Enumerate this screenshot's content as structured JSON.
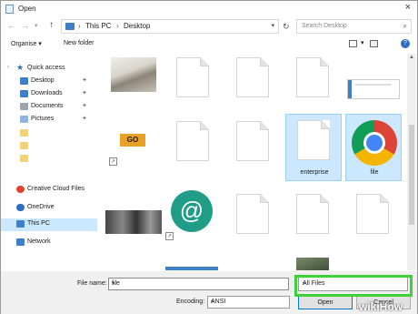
{
  "window": {
    "title": "Open",
    "close_icon": "×"
  },
  "address": {
    "back_icon": "←",
    "forward_icon": "→",
    "dropdown_icon": "▾",
    "up_icon": "↑",
    "crumbs": [
      "This PC",
      "Desktop"
    ],
    "refresh_icon": "↻",
    "search_placeholder": "Search Desktop",
    "search_icon": "⌕"
  },
  "toolbar": {
    "organise": "Organise ▾",
    "new_folder": "New folder",
    "help": "?"
  },
  "nav": {
    "items": [
      {
        "label": "Quick access",
        "icon": "star-icon",
        "color": "#2f6dc2"
      },
      {
        "label": "Desktop",
        "icon": "desktop-icon",
        "color": "#3f7ec8",
        "pin": "📌"
      },
      {
        "label": "Downloads",
        "icon": "download-icon",
        "color": "#3f7ec8",
        "pin": "📌"
      },
      {
        "label": "Documents",
        "icon": "documents-icon",
        "color": "#9aa4b0",
        "pin": "📌"
      },
      {
        "label": "Pictures",
        "icon": "pictures-icon",
        "color": "#8fb5de",
        "pin": "📌"
      },
      {
        "label": "",
        "icon": "folder-icon",
        "color": "#f4d27a"
      },
      {
        "label": "",
        "icon": "folder-icon",
        "color": "#f4d27a"
      },
      {
        "label": "",
        "icon": "folder-icon",
        "color": "#f4d27a"
      },
      {
        "label": "Creative Cloud Files",
        "icon": "creative-cloud-icon",
        "color": "#e0452b"
      },
      {
        "label": "OneDrive",
        "icon": "onedrive-icon",
        "color": "#2f6dc2"
      },
      {
        "label": "This PC",
        "icon": "pc-icon",
        "color": "#3f7ec8"
      },
      {
        "label": "Network",
        "icon": "network-icon",
        "color": "#3f7ec8"
      }
    ]
  },
  "content": {
    "enterprise_label": "enterprise",
    "file_label": "file",
    "shortcut_glyph": "↗",
    "go_label": "GO"
  },
  "bottom": {
    "file_name_label": "File name:",
    "file_name_value": "file",
    "file_type_value": "All Files",
    "encoding_label": "Encoding:",
    "encoding_value": "ANSI",
    "open_button": "Open",
    "cancel_button": "Cancel",
    "dropdown_icon": "▾"
  },
  "watermark": {
    "text": "wikiHow"
  },
  "colors": {
    "selection": "#cce8ff",
    "highlight_box": "#40d13a",
    "accent": "#0078d7"
  }
}
